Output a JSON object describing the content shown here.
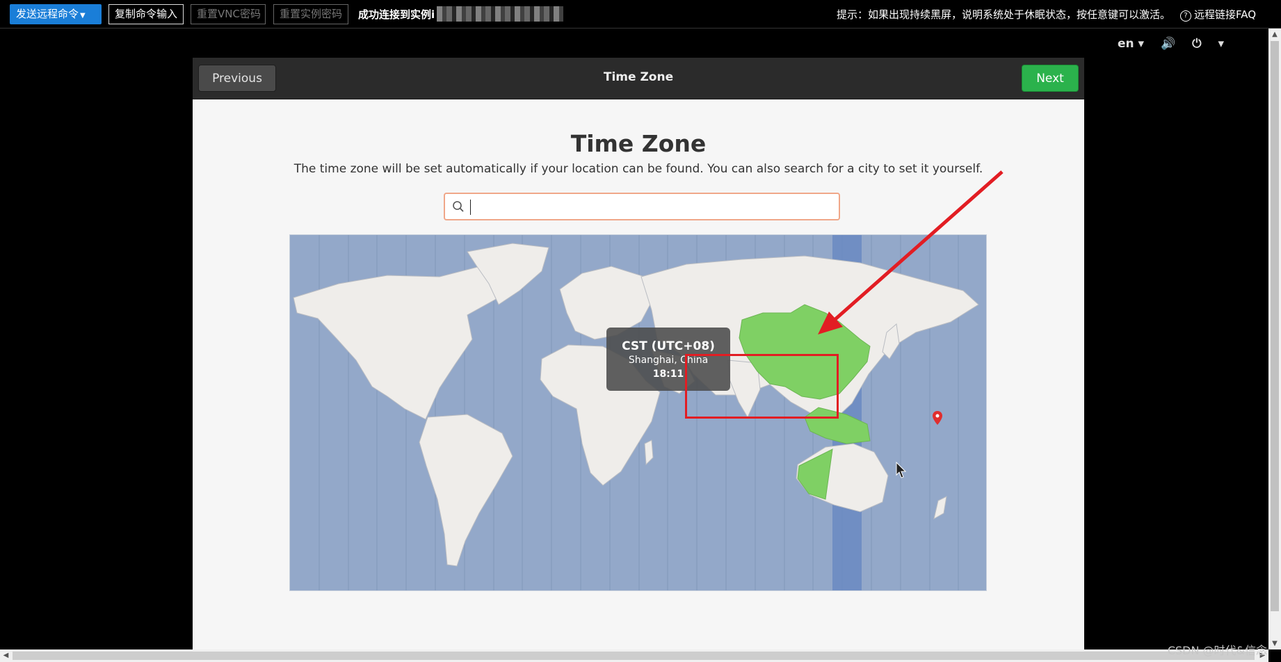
{
  "toolbar": {
    "send_command": "发送远程命令",
    "copy_input": "复制命令输入",
    "reset_vnc": "重置VNC密码",
    "reset_instance": "重置实例密码",
    "status": "成功连接到实例i",
    "hint": "提示：如果出现持续黑屏，说明系统处于休眠状态，按任意键可以激活。",
    "faq": "远程链接FAQ"
  },
  "gnome": {
    "language": "en"
  },
  "headerbar": {
    "previous": "Previous",
    "title": "Time Zone",
    "next": "Next"
  },
  "page": {
    "title": "Time Zone",
    "description": "The time zone will be set automatically if your location can be found. You can also search for a city to set it yourself.",
    "search_value": ""
  },
  "timezone": {
    "name": "CST (UTC+08)",
    "city": "Shanghai, China",
    "time": "18:11"
  },
  "watermark": "CSDN @时代&信念",
  "colors": {
    "ocean": "#93a8c9",
    "land": "#efedea",
    "selected_zone": "#7fd064",
    "selected_band": "#6a89c2",
    "next_button": "#2bb24c",
    "annotation": "#e21d23"
  }
}
